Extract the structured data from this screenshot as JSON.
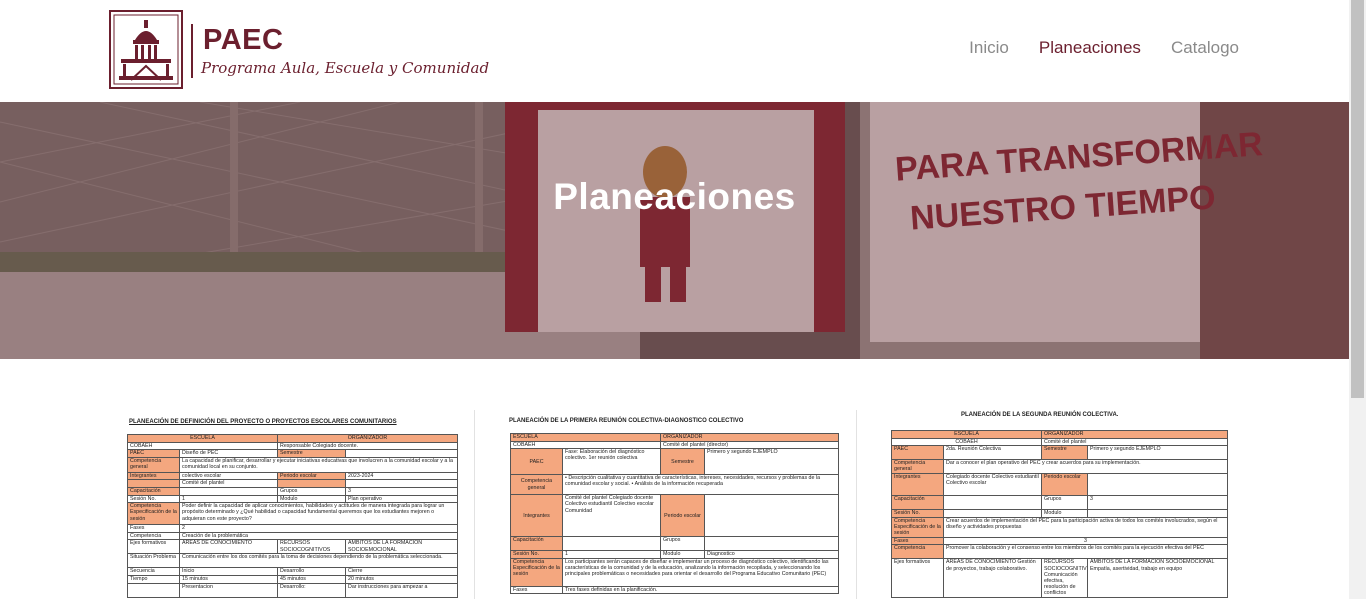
{
  "header": {
    "brand_name": "PAEC",
    "brand_tagline": "Programa Aula, Escuela y Comunidad",
    "logo_icon": "capitol-building-icon",
    "nav": [
      {
        "label": "Inicio",
        "active": false
      },
      {
        "label": "Planeaciones",
        "active": true
      },
      {
        "label": "Catalogo",
        "active": false
      }
    ]
  },
  "hero": {
    "title": "Planeaciones",
    "background_text": [
      "PARA TRANSFORMAR",
      "NUESTRO TIEMPO"
    ]
  },
  "colors": {
    "brand": "#6b1f2e",
    "nav_inactive": "#8a8a8a",
    "table_header": "#f4a77f"
  },
  "docs": [
    {
      "title": "PLANEACIÓN DE DEFINICIÓN DEL PROYECTO O PROYECTOS ESCOLARES COMUNITARIOS",
      "rows": [
        [
          "ESCUELA",
          "ORGANIZADOR"
        ],
        [
          "COBAEH",
          "Responsable Colegiado docente."
        ],
        [
          "PAEC",
          "Diseño de PEC",
          "Semestre",
          ""
        ],
        [
          "Competencia general",
          "La capacidad de planificar, desarrollar y ejecutar iniciativas educativas que involucren a la comunidad escolar y a la comunidad local en su conjunto."
        ],
        [
          "Integrantes",
          "colectivo escolar",
          "Periodo escolar",
          "2023-2024"
        ],
        [
          "",
          "Comité del plantel",
          "",
          ""
        ],
        [
          "Capacitación",
          "",
          "Grupos",
          "3"
        ],
        [
          "Sesión No.",
          "1",
          "Modulo",
          "Plan operativo"
        ],
        [
          "Competencia Especificación de la sesión",
          "Poder definir la capacidad de aplicar conocimientos, habilidades y actitudes de manera integrada para lograr un propósito determinado y ¿Qué habilidad o capacidad fundamental queremos que los estudiantes mejoren o adquieran con este proyecto?"
        ],
        [
          "Fases",
          "2"
        ],
        [
          "Competencia",
          "Creación de la problemática"
        ],
        [
          "Ejes formativos",
          "AREAS DE CONOCIMIENTO",
          "RECURSOS SOCIOCOGNITIVOS",
          "AMBITOS DE LA FORMACIÓN SOCIOEMOCIONAL"
        ],
        [
          "Situación Problema",
          "Comunicación entre los dos comités para la toma de decisiones dependiendo de la problemática seleccionada."
        ],
        [
          "Secuencia",
          "Inicio",
          "Desarrollo",
          "Cierre"
        ],
        [
          "Tiempo",
          "15 minutos",
          "45 minutos",
          "20 minutos"
        ],
        [
          "",
          "Presentacion",
          "Desarrollo:",
          "Dar instrucciones para ampezar a"
        ]
      ]
    },
    {
      "title": "PLANEACIÓN DE LA PRIMERA REUNIÓN COLECTIVA-DIAGNOSTICO COLECTIVO",
      "rows": [
        [
          "ESCUELA",
          "ORGANIZADOR"
        ],
        [
          "COBAEH",
          "Comité del plantel (director)"
        ],
        [
          "PAEC",
          "Fase: Elaboración del diagnóstico colectivo. 1er reunión colectiva",
          "Semestre",
          "Primero y segundo EJEMPLO"
        ],
        [
          "Competencia general",
          "• Descripción cualitativa y cuantitativa de características, intereses, necesidades, recursos y problemas de la comunidad escolar y social. • Análisis de la información recuperada"
        ],
        [
          "Integrantes",
          "Comité del plantel Colegiado docente Colectivo estudiantil Colectivo escolar Comunidad",
          "Periodo escolar",
          ""
        ],
        [
          "Capacitación",
          "",
          "Grupos",
          ""
        ],
        [
          "Sesión No.",
          "1",
          "Modulo",
          "Diagnostico"
        ],
        [
          "Competencia Especificación de la sesión",
          "Los participantes serán capaces de diseñar e implementar un proceso de diagnóstico colectivo, identificando las características de la comunidad y de la educación, analizando la información recopilada, y seleccionando los principales problemáticas o necesidades para orientar el desarrollo del Programa Educativo Comunitario (PEC)"
        ],
        [
          "Fases",
          "Tres fases definidas en la planificación."
        ]
      ]
    },
    {
      "title": "PLANEACIÓN DE LA SEGUNDA REUNIÓN COLECTIVA.",
      "rows": [
        [
          "ESCUELA",
          "ORGANIZADOR"
        ],
        [
          "COBAEH",
          "Comité del plantel"
        ],
        [
          "PAEC",
          "2da. Reunión Colectiva",
          "Semestre",
          "Primero y segundo EJEMPLO"
        ],
        [
          "Competencia general",
          "Dar a conocer el plan operativo del PEC y crear acuerdos para su implementación."
        ],
        [
          "Integrantes",
          "Colegiado docente Colectivo estudiantil Colectivo escolar",
          "Periodo escolar",
          ""
        ],
        [
          "Capacitación",
          "",
          "Grupos",
          "3"
        ],
        [
          "Sesión No.",
          "",
          "Modulo",
          ""
        ],
        [
          "Competencia Especificación de la sesión",
          "Crear acuerdos de implementación del PEC para la participación activa de todos los comités involucrados, según el diseño y actividades propuestas"
        ],
        [
          "Fases",
          "3"
        ],
        [
          "Competencia",
          "Promover la colaboración y el consenso entre los miembros de los comités para la ejecución efectiva del PEC"
        ],
        [
          "Ejes formativos",
          "AREAS DE CONOCIMIENTO Gestión de proyectos, trabajo colaborativo.",
          "RECURSOS SOCIOCOGNITIVOS Comunicación efectiva, resolución de conflictos",
          "AMBITOS DE LA FORMACIÓN SOCIOEMOCIONAL Empatía, asertividad, trabajo en equipo"
        ]
      ]
    }
  ]
}
